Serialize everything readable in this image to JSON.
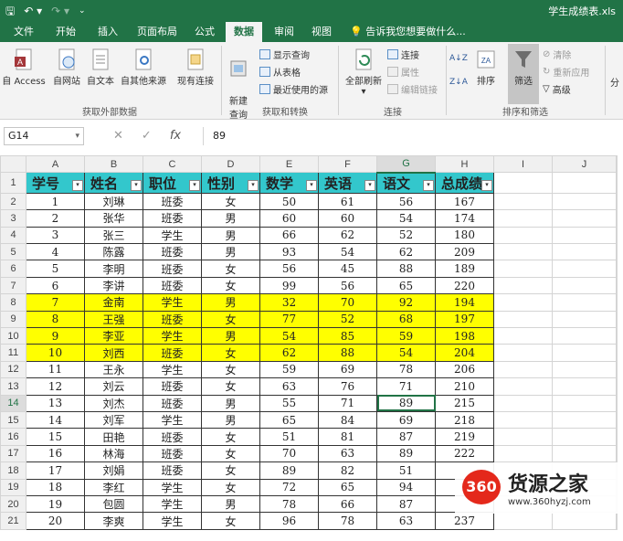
{
  "titlebar": {
    "title": "学生成绩表.xls",
    "save_icon": "save-icon",
    "undo_icon": "undo-icon",
    "redo_icon": "redo-icon"
  },
  "tabs": [
    "文件",
    "开始",
    "插入",
    "页面布局",
    "公式",
    "数据",
    "审阅",
    "视图"
  ],
  "active_tab": "数据",
  "tell_me": "告诉我您想要做什么...",
  "ribbon": {
    "get_external": {
      "label": "获取外部数据",
      "buttons": [
        "自 Access",
        "自网站",
        "自文本",
        "自其他来源",
        "现有连接"
      ]
    },
    "get_transform": {
      "label": "获取和转换",
      "new_query": "新建\n查询",
      "items": [
        "显示查询",
        "从表格",
        "最近使用的源"
      ]
    },
    "connections": {
      "label": "连接",
      "refresh_all": "全部刷新",
      "items": [
        "连接",
        "属性",
        "编辑链接"
      ]
    },
    "sort_filter": {
      "label": "排序和筛选",
      "sort": "排序",
      "filter": "筛选",
      "items": [
        "清除",
        "重新应用",
        "高级"
      ]
    },
    "more": "分"
  },
  "formula_bar": {
    "name_box": "G14",
    "value": "89"
  },
  "columns": [
    "A",
    "B",
    "C",
    "D",
    "E",
    "F",
    "G",
    "H",
    "I",
    "J"
  ],
  "selected_cell": "G14",
  "headers": [
    "学号",
    "姓名",
    "职位",
    "性别",
    "数学",
    "英语",
    "语文",
    "总成绩"
  ],
  "rows": [
    [
      "1",
      "刘琳",
      "班委",
      "女",
      "50",
      "61",
      "56",
      "167"
    ],
    [
      "2",
      "张华",
      "班委",
      "男",
      "60",
      "60",
      "54",
      "174"
    ],
    [
      "3",
      "张三",
      "学生",
      "男",
      "66",
      "62",
      "52",
      "180"
    ],
    [
      "4",
      "陈露",
      "班委",
      "男",
      "93",
      "54",
      "62",
      "209"
    ],
    [
      "5",
      "李明",
      "班委",
      "女",
      "56",
      "45",
      "88",
      "189"
    ],
    [
      "6",
      "李讲",
      "班委",
      "女",
      "99",
      "56",
      "65",
      "220"
    ],
    [
      "7",
      "金南",
      "学生",
      "男",
      "32",
      "70",
      "92",
      "194"
    ],
    [
      "8",
      "王强",
      "班委",
      "女",
      "77",
      "52",
      "68",
      "197"
    ],
    [
      "9",
      "李亚",
      "学生",
      "男",
      "54",
      "85",
      "59",
      "198"
    ],
    [
      "10",
      "刘西",
      "班委",
      "女",
      "62",
      "88",
      "54",
      "204"
    ],
    [
      "11",
      "王永",
      "学生",
      "女",
      "59",
      "69",
      "78",
      "206"
    ],
    [
      "12",
      "刘云",
      "班委",
      "女",
      "63",
      "76",
      "71",
      "210"
    ],
    [
      "13",
      "刘杰",
      "班委",
      "男",
      "55",
      "71",
      "89",
      "215"
    ],
    [
      "14",
      "刘军",
      "学生",
      "男",
      "65",
      "84",
      "69",
      "218"
    ],
    [
      "15",
      "田艳",
      "班委",
      "女",
      "51",
      "81",
      "87",
      "219"
    ],
    [
      "16",
      "林海",
      "班委",
      "女",
      "70",
      "63",
      "89",
      "222"
    ],
    [
      "17",
      "刘娟",
      "班委",
      "女",
      "89",
      "82",
      "51",
      ""
    ],
    [
      "18",
      "李红",
      "学生",
      "女",
      "72",
      "65",
      "94",
      ""
    ],
    [
      "19",
      "包圆",
      "学生",
      "男",
      "78",
      "66",
      "87",
      ""
    ],
    [
      "20",
      "李爽",
      "学生",
      "女",
      "96",
      "78",
      "63",
      "237"
    ]
  ],
  "highlight_rows": [
    7,
    8,
    9,
    10
  ],
  "highlight_color": "#ffff00",
  "header_fill_color": "#33c7cc",
  "accent_color": "#217346",
  "watermark": {
    "logo": "360",
    "name": "货源之家",
    "url": "www.360hyzj.com"
  }
}
